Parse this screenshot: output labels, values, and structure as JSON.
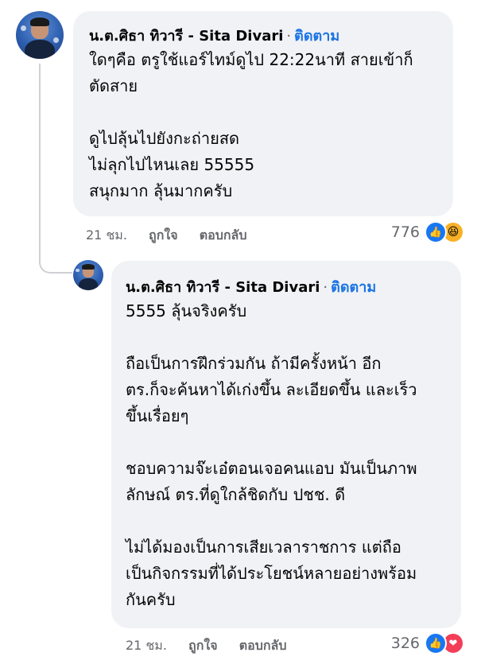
{
  "comments": [
    {
      "author": "น.ต.ศิธา ทิวารี - Sita Divari",
      "separator": "·",
      "follow_label": "ติดตาม",
      "lines": [
        "ใดๆคือ ตรูใช้แอร์ไทม์ดูไป 22:22นาที สายเข้าก็",
        "ตัดสาย",
        "",
        "ดูไปลุ้นไปยังกะถ่ายสด",
        "ไม่ลุกไปไหนเลย 55555",
        "สนุกมาก ลุ้นมากครับ"
      ],
      "time": "21 ชม.",
      "like_label": "ถูกใจ",
      "reply_label": "ตอบกลับ",
      "reaction_count": "776",
      "reaction_icons": [
        "like-icon",
        "haha-icon"
      ]
    },
    {
      "author": "น.ต.ศิธา ทิวารี - Sita Divari",
      "separator": "·",
      "follow_label": "ติดตาม",
      "lines": [
        "5555 ลุ้นจริงครับ",
        "",
        "ถือเป็นการฝึกร่วมกัน ถ้ามีครั้งหน้า อีก",
        "ตร.ก็จะค้นหาได้เก่งขึ้น ละเอียดขึ้น และเร็ว",
        "ขึ้นเรื่อยๆ",
        "",
        "ชอบความจ๊ะเอ๋ตอนเจอคนแอบ  มันเป็นภาพ",
        "ลักษณ์ ตร.ที่ดูใกล้ชิดกับ ปชช. ดี",
        "",
        "ไม่ได้มองเป็นการเสียเวลาราชการ แต่ถือ",
        "เป็นกิจกรรมที่ได้ประโยชน์หลายอย่างพร้อม",
        "กันครับ"
      ],
      "time": "21 ชม.",
      "like_label": "ถูกใจ",
      "reply_label": "ตอบกลับ",
      "reaction_count": "326",
      "reaction_icons": [
        "like-icon",
        "love-icon"
      ]
    }
  ],
  "colors": {
    "bubble": "#f0f2f5",
    "follow": "#1b74e4",
    "meta": "#65676b",
    "like": "#1877f2",
    "haha": "#f7b125",
    "love": "#f33e58"
  }
}
